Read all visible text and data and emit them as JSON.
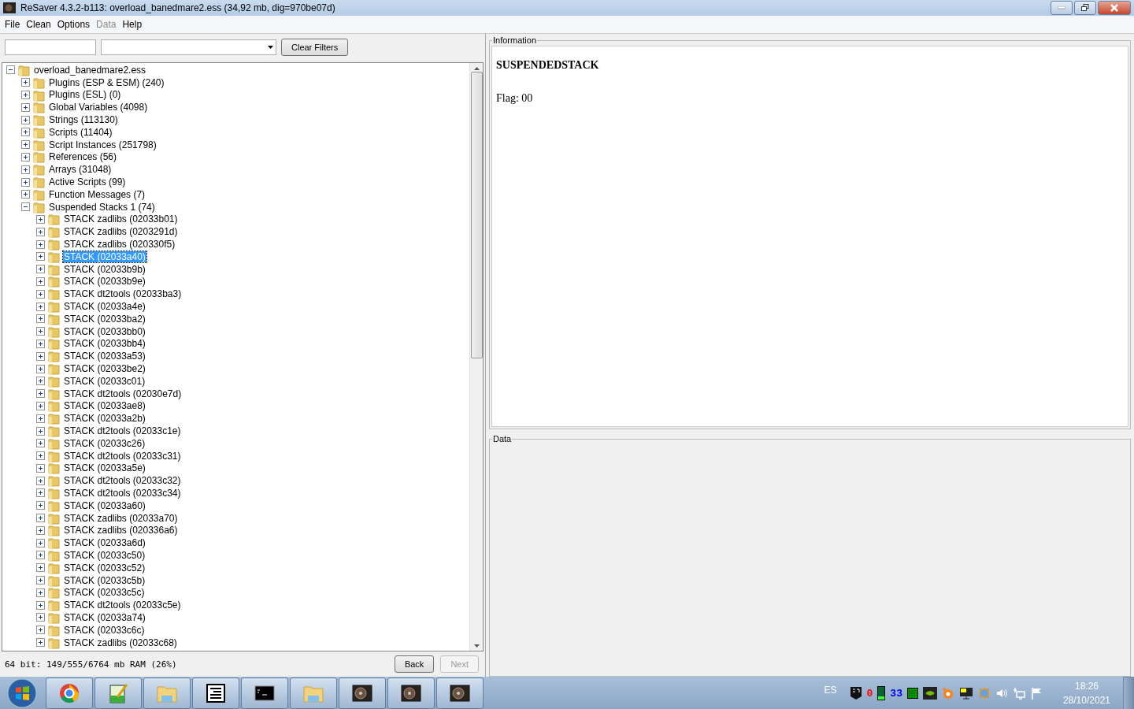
{
  "window": {
    "title": "ReSaver 4.3.2-b113: overload_banedmare2.ess (34,92 mb, dig=970be07d)"
  },
  "menu": [
    {
      "label": "File",
      "disabled": false
    },
    {
      "label": "Clean",
      "disabled": false
    },
    {
      "label": "Options",
      "disabled": false
    },
    {
      "label": "Data",
      "disabled": true
    },
    {
      "label": "Help",
      "disabled": false
    }
  ],
  "filter_bar": {
    "clear_button": "Clear Filters"
  },
  "tree": [
    {
      "label": "overload_banedmare2.ess",
      "expanded": true,
      "selected": false,
      "children": [
        {
          "label": "Plugins (ESP & ESM) (240)",
          "expanded": false,
          "selected": false
        },
        {
          "label": "Plugins (ESL) (0)",
          "expanded": false,
          "selected": false
        },
        {
          "label": "Global Variables (4098)",
          "expanded": false,
          "selected": false
        },
        {
          "label": "Strings (113130)",
          "expanded": false,
          "selected": false
        },
        {
          "label": "Scripts (11404)",
          "expanded": false,
          "selected": false
        },
        {
          "label": "Script Instances (251798)",
          "expanded": false,
          "selected": false
        },
        {
          "label": "References (56)",
          "expanded": false,
          "selected": false
        },
        {
          "label": "Arrays (31048)",
          "expanded": false,
          "selected": false
        },
        {
          "label": "Active Scripts (99)",
          "expanded": false,
          "selected": false
        },
        {
          "label": "Function Messages (7)",
          "expanded": false,
          "selected": false
        },
        {
          "label": "Suspended Stacks 1 (74)",
          "expanded": true,
          "selected": false,
          "children": [
            {
              "label": "STACK zadlibs (02033b01)",
              "expanded": false,
              "selected": false
            },
            {
              "label": "STACK zadlibs (0203291d)",
              "expanded": false,
              "selected": false
            },
            {
              "label": "STACK zadlibs (020330f5)",
              "expanded": false,
              "selected": false
            },
            {
              "label": "STACK (02033a40)",
              "expanded": false,
              "selected": true
            },
            {
              "label": "STACK (02033b9b)",
              "expanded": false,
              "selected": false
            },
            {
              "label": "STACK (02033b9e)",
              "expanded": false,
              "selected": false
            },
            {
              "label": "STACK dt2tools (02033ba3)",
              "expanded": false,
              "selected": false
            },
            {
              "label": "STACK (02033a4e)",
              "expanded": false,
              "selected": false
            },
            {
              "label": "STACK (02033ba2)",
              "expanded": false,
              "selected": false
            },
            {
              "label": "STACK (02033bb0)",
              "expanded": false,
              "selected": false
            },
            {
              "label": "STACK (02033bb4)",
              "expanded": false,
              "selected": false
            },
            {
              "label": "STACK (02033a53)",
              "expanded": false,
              "selected": false
            },
            {
              "label": "STACK (02033be2)",
              "expanded": false,
              "selected": false
            },
            {
              "label": "STACK (02033c01)",
              "expanded": false,
              "selected": false
            },
            {
              "label": "STACK dt2tools (02030e7d)",
              "expanded": false,
              "selected": false
            },
            {
              "label": "STACK (02033ae8)",
              "expanded": false,
              "selected": false
            },
            {
              "label": "STACK (02033a2b)",
              "expanded": false,
              "selected": false
            },
            {
              "label": "STACK dt2tools (02033c1e)",
              "expanded": false,
              "selected": false
            },
            {
              "label": "STACK (02033c26)",
              "expanded": false,
              "selected": false
            },
            {
              "label": "STACK dt2tools (02033c31)",
              "expanded": false,
              "selected": false
            },
            {
              "label": "STACK (02033a5e)",
              "expanded": false,
              "selected": false
            },
            {
              "label": "STACK dt2tools (02033c32)",
              "expanded": false,
              "selected": false
            },
            {
              "label": "STACK dt2tools (02033c34)",
              "expanded": false,
              "selected": false
            },
            {
              "label": "STACK (02033a60)",
              "expanded": false,
              "selected": false
            },
            {
              "label": "STACK zadlibs (02033a70)",
              "expanded": false,
              "selected": false
            },
            {
              "label": "STACK zadlibs (020336a6)",
              "expanded": false,
              "selected": false
            },
            {
              "label": "STACK (02033a6d)",
              "expanded": false,
              "selected": false
            },
            {
              "label": "STACK (02033c50)",
              "expanded": false,
              "selected": false
            },
            {
              "label": "STACK (02033c52)",
              "expanded": false,
              "selected": false
            },
            {
              "label": "STACK (02033c5b)",
              "expanded": false,
              "selected": false
            },
            {
              "label": "STACK (02033c5c)",
              "expanded": false,
              "selected": false
            },
            {
              "label": "STACK dt2tools (02033c5e)",
              "expanded": false,
              "selected": false
            },
            {
              "label": "STACK (02033a74)",
              "expanded": false,
              "selected": false
            },
            {
              "label": "STACK (02033c6c)",
              "expanded": false,
              "selected": false
            },
            {
              "label": "STACK zadlibs (02033c68)",
              "expanded": false,
              "selected": false
            }
          ]
        }
      ]
    }
  ],
  "status_bar": {
    "memory": "64 bit: 149/555/6764 mb RAM (26%)",
    "buttons": [
      {
        "label": "Back",
        "disabled": false
      },
      {
        "label": "Next",
        "disabled": true
      }
    ]
  },
  "information": {
    "legend": "Information",
    "heading": "SUSPENDEDSTACK",
    "flag": "Flag: 00"
  },
  "data_panel": {
    "legend": "Data"
  },
  "taskbar": {
    "apps": [
      {
        "kind": "chrome"
      },
      {
        "kind": "notepad"
      },
      {
        "kind": "folder"
      },
      {
        "kind": "document"
      },
      {
        "kind": "terminal"
      },
      {
        "kind": "folder"
      },
      {
        "kind": "disk"
      },
      {
        "kind": "disk"
      },
      {
        "kind": "disk"
      }
    ],
    "language": "ES",
    "tray": [
      {
        "kind": "shield"
      },
      {
        "kind": "text",
        "text": "0",
        "color": "#ff0000"
      },
      {
        "kind": "bar"
      },
      {
        "kind": "text",
        "text": "33",
        "color": "#0000ff"
      },
      {
        "kind": "grid"
      },
      {
        "kind": "eye"
      },
      {
        "kind": "splat"
      },
      {
        "kind": "monitor"
      },
      {
        "kind": "update"
      },
      {
        "kind": "speaker"
      },
      {
        "kind": "network"
      },
      {
        "kind": "flag"
      }
    ],
    "time": "18:26",
    "date": "28/10/2021"
  }
}
